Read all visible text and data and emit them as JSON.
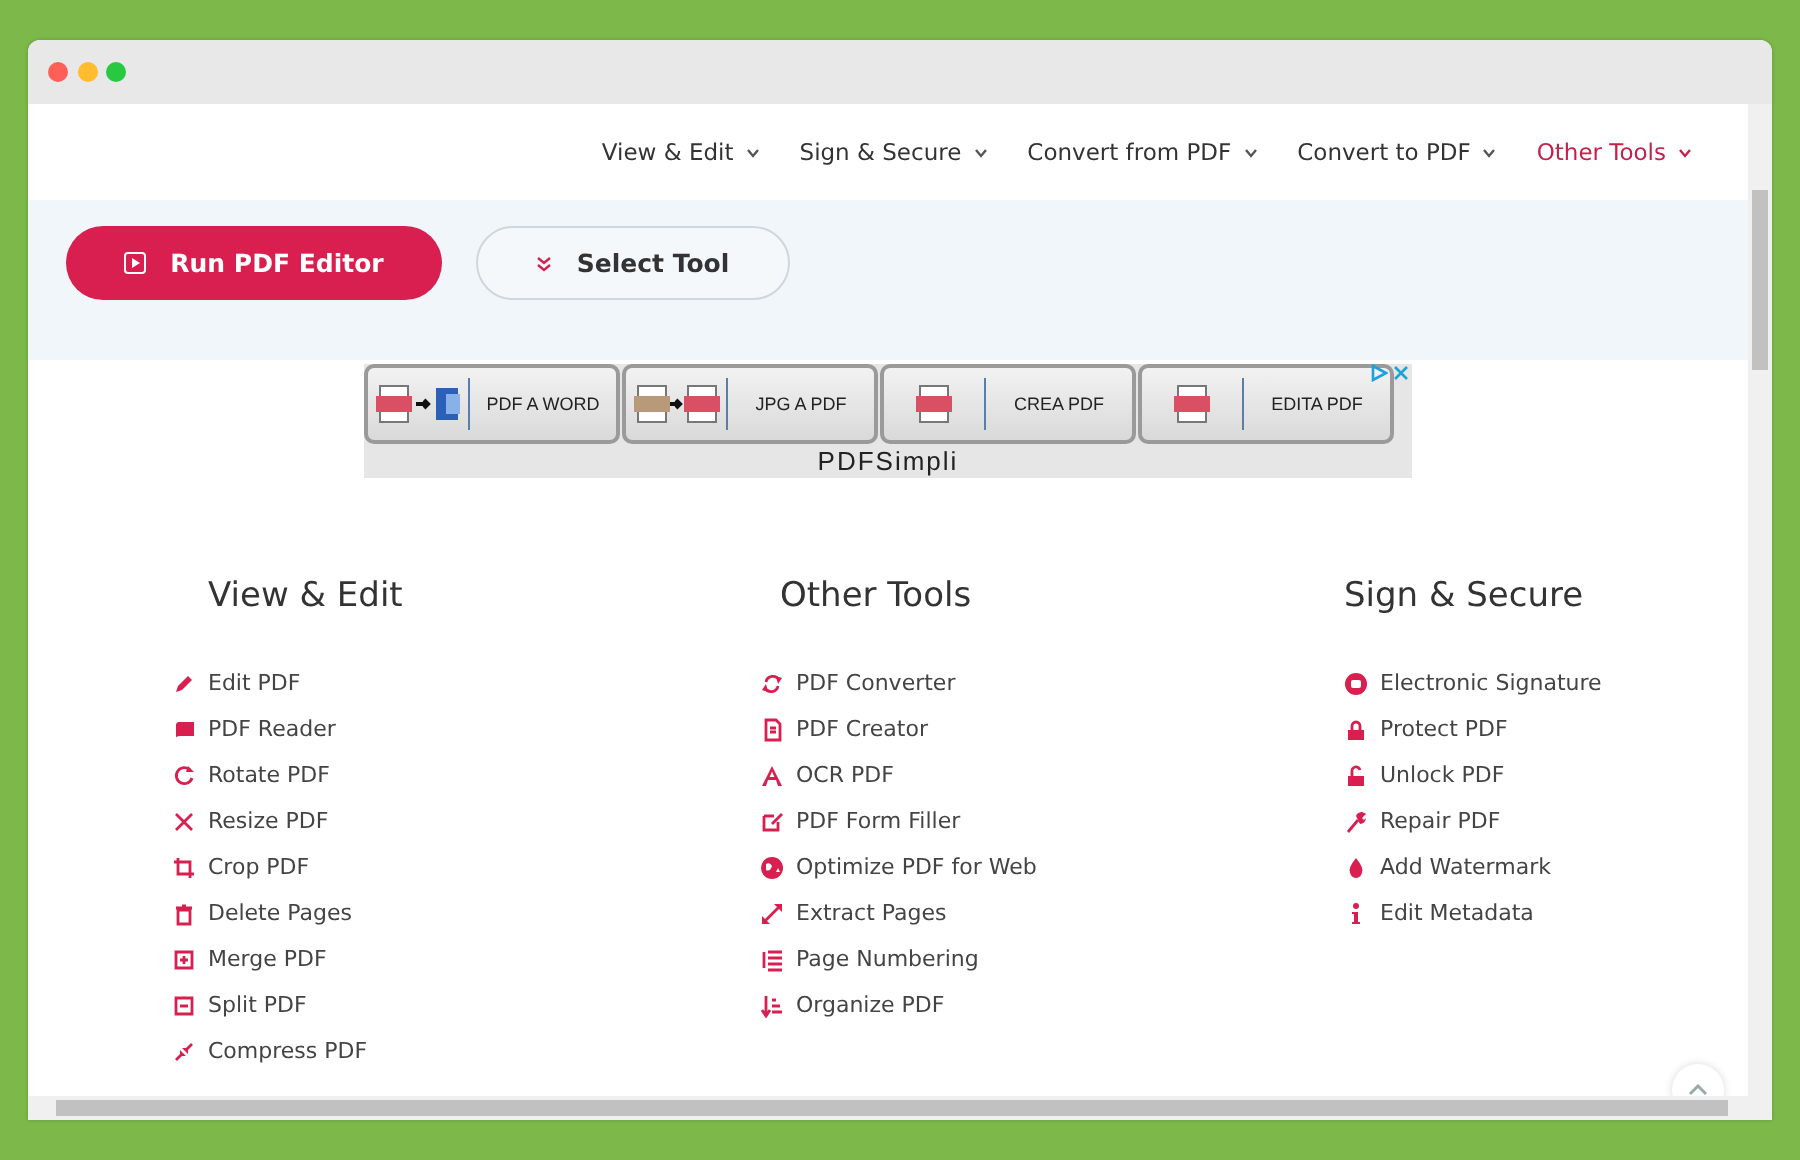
{
  "nav": [
    {
      "label": "View & Edit",
      "selected": false
    },
    {
      "label": "Sign & Secure",
      "selected": false
    },
    {
      "label": "Convert from PDF",
      "selected": false
    },
    {
      "label": "Convert to PDF",
      "selected": false
    },
    {
      "label": "Other Tools",
      "selected": true
    }
  ],
  "hero": {
    "primary_button": "Run PDF Editor",
    "secondary_button": "Select Tool"
  },
  "ad": {
    "tiles": [
      "PDF A WORD",
      "JPG A PDF",
      "CREA PDF",
      "EDITA PDF"
    ],
    "sponsor": "PDFSimpli"
  },
  "columns": [
    {
      "title": "View & Edit",
      "items": [
        "Edit PDF",
        "PDF Reader",
        "Rotate PDF",
        "Resize PDF",
        "Crop PDF",
        "Delete Pages",
        "Merge PDF",
        "Split PDF",
        "Compress PDF"
      ]
    },
    {
      "title": "Other Tools",
      "items": [
        "PDF Converter",
        "PDF Creator",
        "OCR PDF",
        "PDF Form Filler",
        "Optimize PDF for Web",
        "Extract Pages",
        "Page Numbering",
        "Organize PDF"
      ]
    },
    {
      "title": "Sign & Secure",
      "items": [
        "Electronic Signature",
        "Protect PDF",
        "Unlock PDF",
        "Repair PDF",
        "Add Watermark",
        "Edit Metadata"
      ]
    }
  ]
}
